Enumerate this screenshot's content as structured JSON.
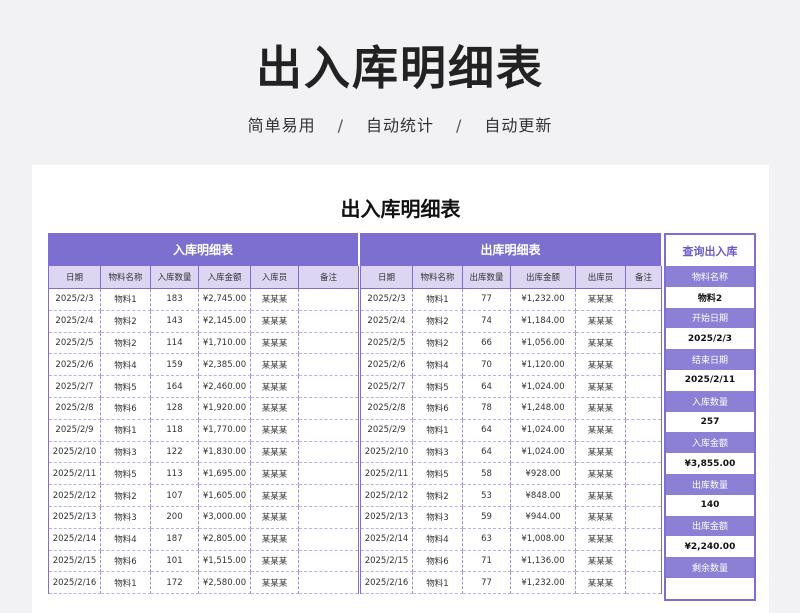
{
  "header": {
    "title": "出入库明细表",
    "tags": [
      "简单易用",
      "自动统计",
      "自动更新"
    ],
    "separator": "/"
  },
  "sheet": {
    "title": "出入库明细表",
    "in": {
      "title": "入库明细表",
      "columns": [
        "日期",
        "物料名称",
        "入库数量",
        "入库金额",
        "入库员",
        "备注"
      ],
      "rows": [
        [
          "2025/2/3",
          "物料1",
          "183",
          "¥2,745.00",
          "某某某",
          ""
        ],
        [
          "2025/2/4",
          "物料2",
          "143",
          "¥2,145.00",
          "某某某",
          ""
        ],
        [
          "2025/2/5",
          "物料2",
          "114",
          "¥1,710.00",
          "某某某",
          ""
        ],
        [
          "2025/2/6",
          "物料4",
          "159",
          "¥2,385.00",
          "某某某",
          ""
        ],
        [
          "2025/2/7",
          "物料5",
          "164",
          "¥2,460.00",
          "某某某",
          ""
        ],
        [
          "2025/2/8",
          "物料6",
          "128",
          "¥1,920.00",
          "某某某",
          ""
        ],
        [
          "2025/2/9",
          "物料1",
          "118",
          "¥1,770.00",
          "某某某",
          ""
        ],
        [
          "2025/2/10",
          "物料3",
          "122",
          "¥1,830.00",
          "某某某",
          ""
        ],
        [
          "2025/2/11",
          "物料5",
          "113",
          "¥1,695.00",
          "某某某",
          ""
        ],
        [
          "2025/2/12",
          "物料2",
          "107",
          "¥1,605.00",
          "某某某",
          ""
        ],
        [
          "2025/2/13",
          "物料3",
          "200",
          "¥3,000.00",
          "某某某",
          ""
        ],
        [
          "2025/2/14",
          "物料4",
          "187",
          "¥2,805.00",
          "某某某",
          ""
        ],
        [
          "2025/2/15",
          "物料6",
          "101",
          "¥1,515.00",
          "某某某",
          ""
        ],
        [
          "2025/2/16",
          "物料1",
          "172",
          "¥2,580.00",
          "某某某",
          ""
        ]
      ]
    },
    "out": {
      "title": "出库明细表",
      "columns": [
        "日期",
        "物料名称",
        "出库数量",
        "出库金额",
        "出库员",
        "备注"
      ],
      "rows": [
        [
          "2025/2/3",
          "物料1",
          "77",
          "¥1,232.00",
          "某某某",
          ""
        ],
        [
          "2025/2/4",
          "物料2",
          "74",
          "¥1,184.00",
          "某某某",
          ""
        ],
        [
          "2025/2/5",
          "物料2",
          "66",
          "¥1,056.00",
          "某某某",
          ""
        ],
        [
          "2025/2/6",
          "物料4",
          "70",
          "¥1,120.00",
          "某某某",
          ""
        ],
        [
          "2025/2/7",
          "物料5",
          "64",
          "¥1,024.00",
          "某某某",
          ""
        ],
        [
          "2025/2/8",
          "物料6",
          "78",
          "¥1,248.00",
          "某某某",
          ""
        ],
        [
          "2025/2/9",
          "物料1",
          "64",
          "¥1,024.00",
          "某某某",
          ""
        ],
        [
          "2025/2/10",
          "物料3",
          "64",
          "¥1,024.00",
          "某某某",
          ""
        ],
        [
          "2025/2/11",
          "物料5",
          "58",
          "¥928.00",
          "某某某",
          ""
        ],
        [
          "2025/2/12",
          "物料2",
          "53",
          "¥848.00",
          "某某某",
          ""
        ],
        [
          "2025/2/13",
          "物料3",
          "59",
          "¥944.00",
          "某某某",
          ""
        ],
        [
          "2025/2/14",
          "物料4",
          "63",
          "¥1,008.00",
          "某某某",
          ""
        ],
        [
          "2025/2/15",
          "物料6",
          "71",
          "¥1,136.00",
          "某某某",
          ""
        ],
        [
          "2025/2/16",
          "物料1",
          "77",
          "¥1,232.00",
          "某某某",
          ""
        ]
      ]
    },
    "query": {
      "title": "查询出入库",
      "items": [
        {
          "label": "物料名称",
          "value": "物料2"
        },
        {
          "label": "开始日期",
          "value": "2025/2/3"
        },
        {
          "label": "结束日期",
          "value": "2025/2/11"
        },
        {
          "label": "入库数量",
          "value": "257"
        },
        {
          "label": "入库金额",
          "value": "¥3,855.00"
        },
        {
          "label": "出库数量",
          "value": "140"
        },
        {
          "label": "出库金额",
          "value": "¥2,240.00"
        },
        {
          "label": "剩余数量",
          "value": ""
        }
      ]
    }
  },
  "colors": {
    "accent": "#7c6fcf",
    "header_row": "#dcd6f3",
    "query_label": "#8b7fd6"
  }
}
